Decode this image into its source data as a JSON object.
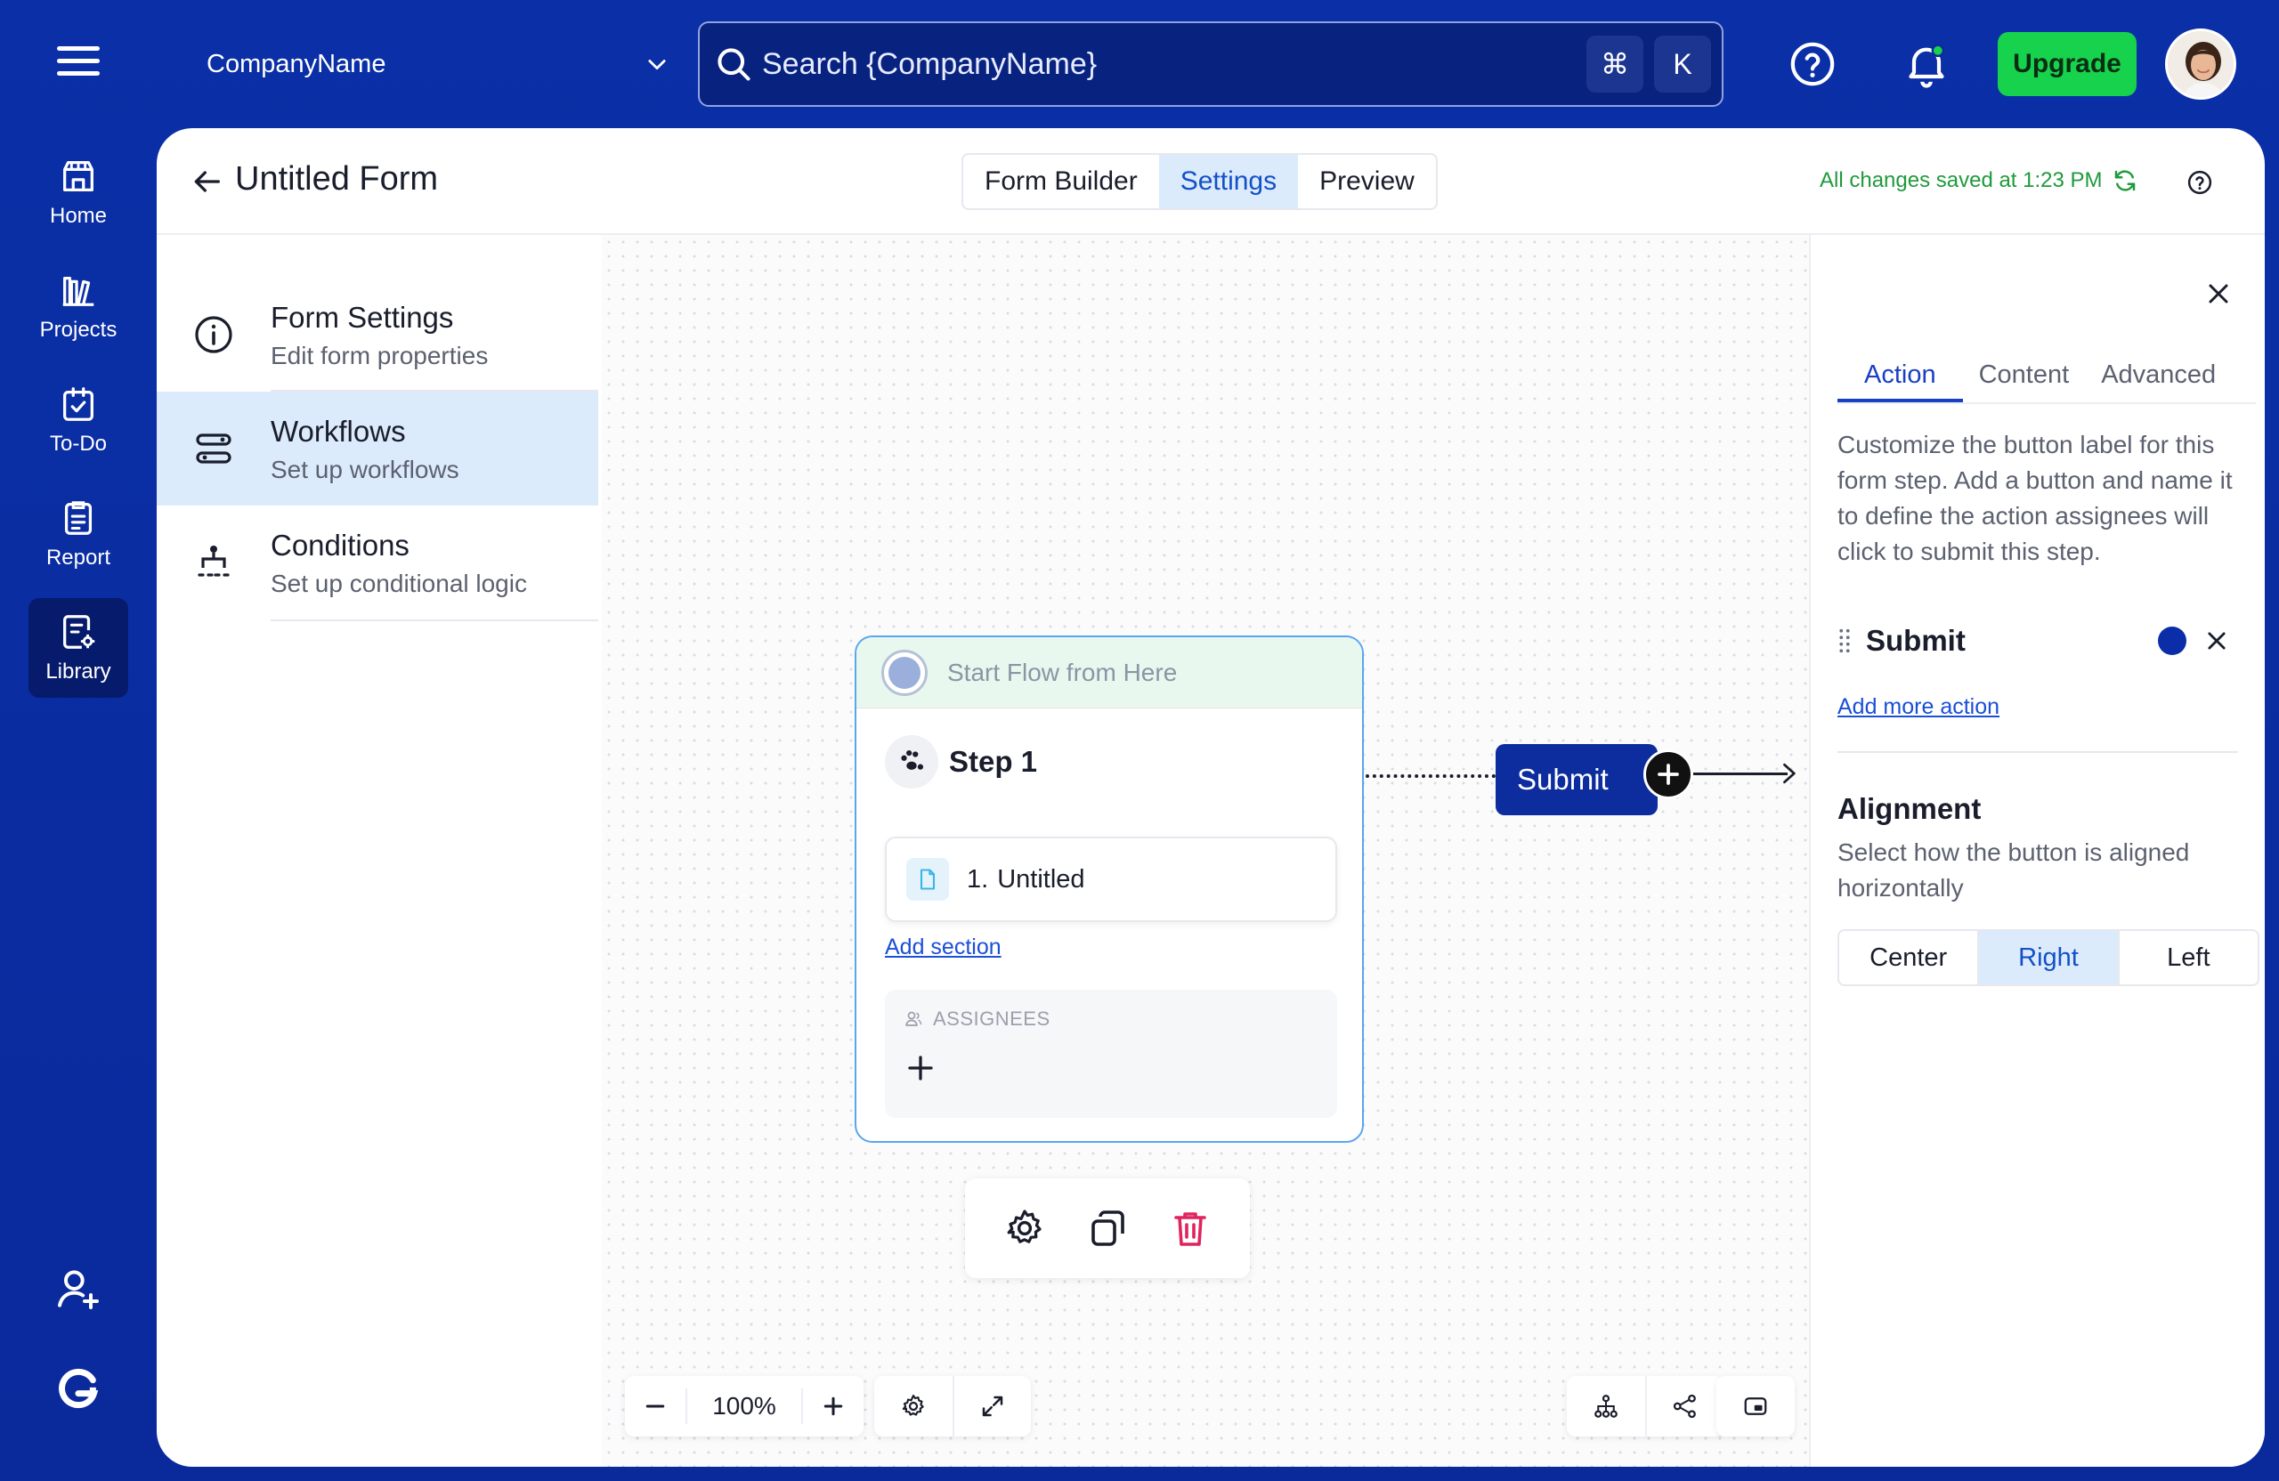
{
  "topbar": {
    "company": "CompanyName",
    "search_placeholder": "Search {CompanyName}",
    "kbd_cmd": "⌘",
    "kbd_key": "K",
    "upgrade_label": "Upgrade"
  },
  "rail": {
    "items": [
      {
        "label": "Home",
        "icon": "home-icon"
      },
      {
        "label": "Projects",
        "icon": "projects-icon"
      },
      {
        "label": "To-Do",
        "icon": "todo-icon"
      },
      {
        "label": "Report",
        "icon": "report-icon"
      },
      {
        "label": "Library",
        "icon": "library-icon",
        "active": true
      }
    ]
  },
  "header": {
    "title": "Untitled Form",
    "tabs": [
      "Form Builder",
      "Settings",
      "Preview"
    ],
    "active_tab": "Settings",
    "saved_status": "All changes saved at 1:23 PM"
  },
  "settings_nav": [
    {
      "title": "Form Settings",
      "subtitle": "Edit form properties",
      "icon": "info-icon"
    },
    {
      "title": "Workflows",
      "subtitle": "Set up workflows",
      "icon": "workflow-icon",
      "active": true
    },
    {
      "title": "Conditions",
      "subtitle": "Set up conditional logic",
      "icon": "conditions-icon"
    }
  ],
  "flow": {
    "start_label": "Start Flow from Here",
    "step_title": "Step 1",
    "section_number": "1.",
    "section_name": "Untitled",
    "add_section_label": "Add section",
    "assignees_label": "ASSIGNEES",
    "submit_label": "Submit"
  },
  "zoom": {
    "value": "100%"
  },
  "right_panel": {
    "tabs": [
      "Action",
      "Content",
      "Advanced"
    ],
    "active_tab": "Action",
    "description": "Customize the button label for this form step. Add a button and name it to define the action assignees will click to submit this step.",
    "action_name": "Submit",
    "action_color": "#0b2ea8",
    "add_more_label": "Add more action",
    "alignment_title": "Alignment",
    "alignment_desc": "Select how the button is aligned horizontally",
    "alignment_options": [
      "Center",
      "Right",
      "Left"
    ],
    "alignment_selected": "Right"
  },
  "colors": {
    "brand": "#0a2a9c",
    "upgrade": "#16d24c",
    "accent": "#1350c8",
    "saved": "#1f9a3c",
    "delete": "#e0245e"
  }
}
